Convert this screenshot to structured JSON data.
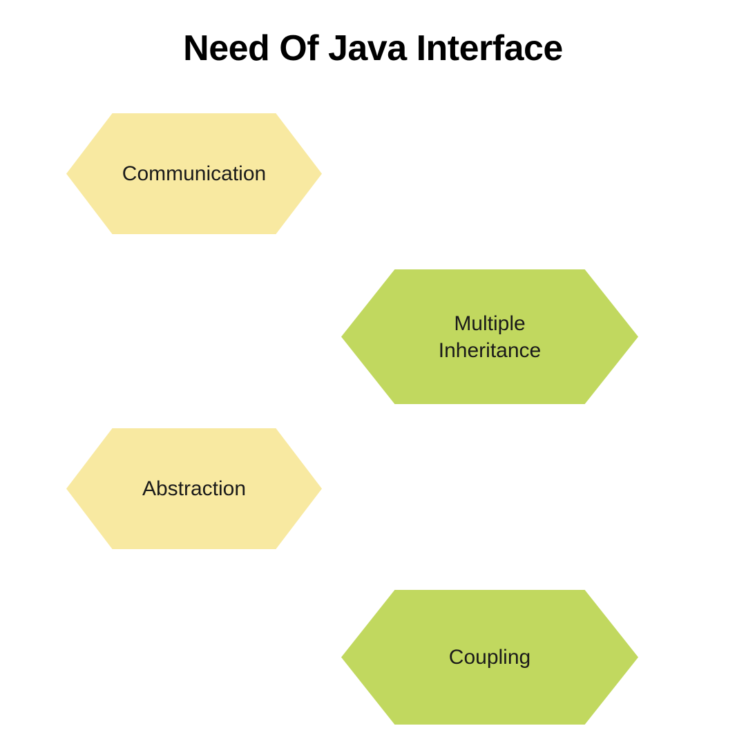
{
  "title": "Need Of Java Interface",
  "shapes": [
    {
      "label": "Communication",
      "color": "yellow"
    },
    {
      "label": "Multiple\nInheritance",
      "color": "green"
    },
    {
      "label": "Abstraction",
      "color": "yellow"
    },
    {
      "label": "Coupling",
      "color": "green"
    }
  ],
  "colors": {
    "yellow": "#f8e9a1",
    "green": "#c1d85f"
  }
}
